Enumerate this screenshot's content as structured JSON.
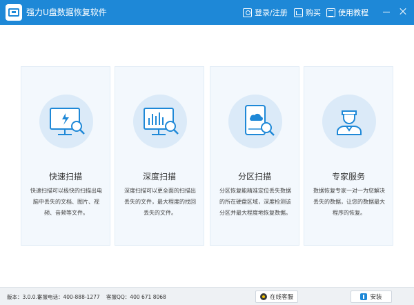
{
  "app": {
    "title": "强力U盘数据恢复软件"
  },
  "header": {
    "login_label": "登录/注册",
    "buy_label": "购买",
    "tutorial_label": "使用教程"
  },
  "cards": [
    {
      "title": "快速扫描",
      "description": "快速扫描可以极快的扫描出电脑中丢失的文档、图片、视频、音频等文件。",
      "icon": "monitor-search-icon"
    },
    {
      "title": "深度扫描",
      "description": "深度扫描可以更全面的扫描出丢失的文件，最大程度的找回丢失的文件。",
      "icon": "chart-search-icon"
    },
    {
      "title": "分区扫描",
      "description": "分区恢复能精准定位丢失数据的所在硬盘区域，深度检测该分区并最大程度地恢复数据。",
      "icon": "disk-search-icon"
    },
    {
      "title": "专家服务",
      "description": "数据恢复专家一对一为您解决丢失的数据，让您的数据最大程序的恢复。",
      "icon": "expert-icon"
    }
  ],
  "footer": {
    "version": "版本：3.0.0.1",
    "phone": "客服电话：400-888-1277",
    "qq": "客服QQ：400 671 8068",
    "service_label": "在线客服",
    "install_label": "安装"
  },
  "colors": {
    "accent": "#1e88d7",
    "card_bg": "#f3f8fd",
    "icon_circle": "#dbeaf8"
  }
}
